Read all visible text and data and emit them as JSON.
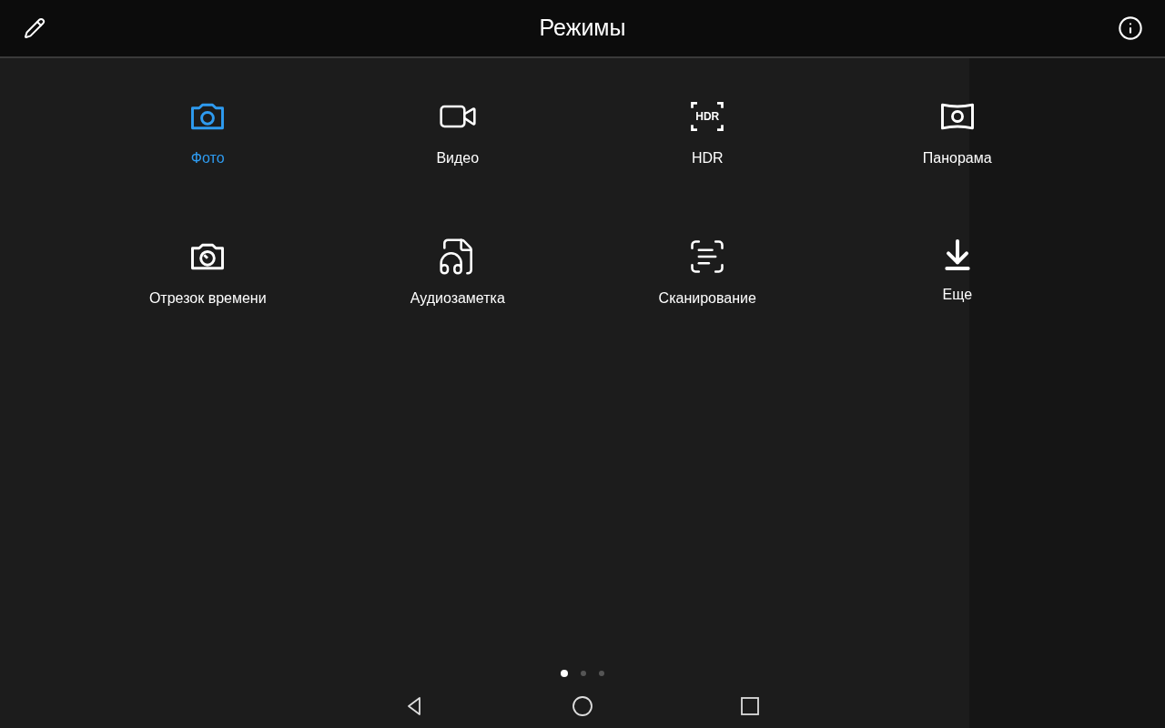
{
  "header": {
    "title": "Режимы"
  },
  "modes": [
    {
      "kind": "photo",
      "label": "Фото",
      "selected": true
    },
    {
      "kind": "video",
      "label": "Видео",
      "selected": false
    },
    {
      "kind": "hdr",
      "label": "HDR",
      "icon_text": "HDR",
      "selected": false
    },
    {
      "kind": "panorama",
      "label": "Панорама",
      "selected": false
    },
    {
      "kind": "timelapse",
      "label": "Отрезок времени",
      "selected": false
    },
    {
      "kind": "audio",
      "label": "Аудиозаметка",
      "selected": false
    },
    {
      "kind": "scan",
      "label": "Сканирование",
      "selected": false
    },
    {
      "kind": "more",
      "label": "Еще",
      "selected": false
    }
  ],
  "pages": [
    {
      "selected": true
    },
    {
      "selected": false
    },
    {
      "selected": false
    }
  ]
}
